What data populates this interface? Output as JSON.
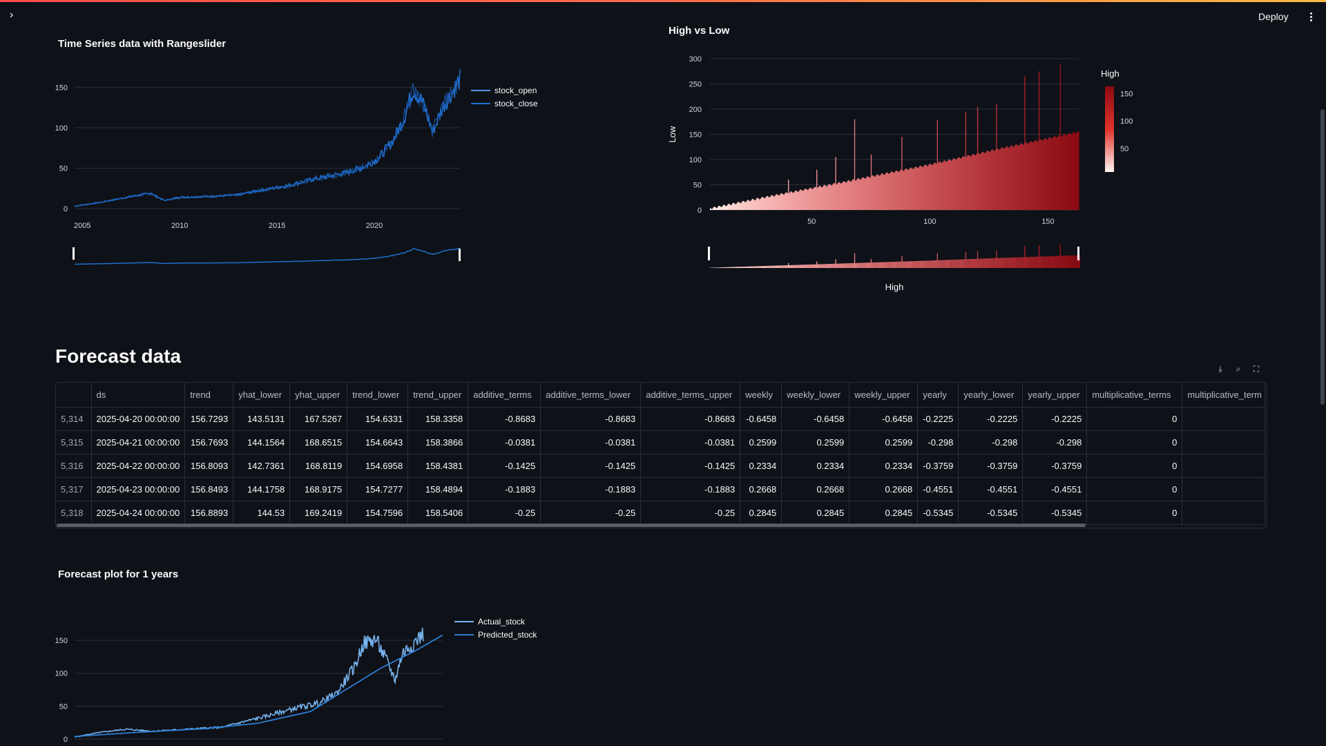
{
  "header": {
    "deploy_label": "Deploy"
  },
  "sections": {
    "ts_title": "Time Series data with Rangeslider",
    "hl_title": "High vs Low",
    "forecast_data_title": "Forecast data",
    "forecast_plot_title": "Forecast plot for 1 years"
  },
  "colors": {
    "accent_blue": "#1f6fd0",
    "light_blue": "#7ab8f5",
    "bg": "#0e1117",
    "red_dark": "#8b0a12",
    "red_light": "#fff5f0"
  },
  "icons": {
    "expand": "chevron-right-icon",
    "menu": "kebab-menu-icon",
    "download": "download-icon",
    "search": "search-icon",
    "fullscreen": "fullscreen-icon"
  },
  "table": {
    "columns": [
      "",
      "ds",
      "trend",
      "yhat_lower",
      "yhat_upper",
      "trend_lower",
      "trend_upper",
      "additive_terms",
      "additive_terms_lower",
      "additive_terms_upper",
      "weekly",
      "weekly_lower",
      "weekly_upper",
      "yearly",
      "yearly_lower",
      "yearly_upper",
      "multiplicative_terms",
      "multiplicative_term"
    ],
    "rows": [
      [
        "5,314",
        "2025-04-20 00:00:00",
        "156.7293",
        "143.5131",
        "167.5267",
        "154.6331",
        "158.3358",
        "-0.8683",
        "-0.8683",
        "-0.8683",
        "-0.6458",
        "-0.6458",
        "-0.6458",
        "-0.2225",
        "-0.2225",
        "-0.2225",
        "0",
        ""
      ],
      [
        "5,315",
        "2025-04-21 00:00:00",
        "156.7693",
        "144.1564",
        "168.6515",
        "154.6643",
        "158.3866",
        "-0.0381",
        "-0.0381",
        "-0.0381",
        "0.2599",
        "0.2599",
        "0.2599",
        "-0.298",
        "-0.298",
        "-0.298",
        "0",
        ""
      ],
      [
        "5,316",
        "2025-04-22 00:00:00",
        "156.8093",
        "142.7361",
        "168.8119",
        "154.6958",
        "158.4381",
        "-0.1425",
        "-0.1425",
        "-0.1425",
        "0.2334",
        "0.2334",
        "0.2334",
        "-0.3759",
        "-0.3759",
        "-0.3759",
        "0",
        ""
      ],
      [
        "5,317",
        "2025-04-23 00:00:00",
        "156.8493",
        "144.1758",
        "168.9175",
        "154.7277",
        "158.4894",
        "-0.1883",
        "-0.1883",
        "-0.1883",
        "0.2668",
        "0.2668",
        "0.2668",
        "-0.4551",
        "-0.4551",
        "-0.4551",
        "0",
        ""
      ],
      [
        "5,318",
        "2025-04-24 00:00:00",
        "156.8893",
        "144.53",
        "169.2419",
        "154.7596",
        "158.5406",
        "-0.25",
        "-0.25",
        "-0.25",
        "0.2845",
        "0.2845",
        "0.2845",
        "-0.5345",
        "-0.5345",
        "-0.5345",
        "0",
        ""
      ]
    ]
  },
  "chart_data": [
    {
      "type": "line",
      "title": "Time Series data with Rangeslider",
      "x_ticks": [
        "2005",
        "2010",
        "2015",
        "2020"
      ],
      "y_ticks": [
        "0",
        "50",
        "100",
        "150"
      ],
      "ylim": [
        0,
        170
      ],
      "xlim": [
        2004.6,
        2024.4
      ],
      "series": [
        {
          "name": "stock_open"
        },
        {
          "name": "stock_close"
        }
      ],
      "x": [
        2004.6,
        2006,
        2007.5,
        2008.5,
        2009.2,
        2010,
        2011.5,
        2013,
        2014,
        2015.5,
        2017,
        2018.5,
        2019.5,
        2020.2,
        2020.9,
        2021.5,
        2022,
        2022.5,
        2023,
        2023.5,
        2024.4
      ],
      "y": [
        3,
        8,
        15,
        19,
        10,
        14,
        15,
        17,
        22,
        28,
        37,
        44,
        52,
        62,
        82,
        110,
        148,
        130,
        95,
        125,
        160
      ],
      "legend": "top-right",
      "rangeslider": true
    },
    {
      "type": "bar",
      "title": "High vs Low",
      "xlabel": "High",
      "ylabel": "Low",
      "x_ticks": [
        "50",
        "100",
        "150"
      ],
      "y_ticks": [
        "0",
        "50",
        "100",
        "150",
        "200",
        "250",
        "300"
      ],
      "xlim": [
        7,
        163
      ],
      "ylim": [
        0,
        300
      ],
      "colorbar": {
        "title": "High",
        "ticks": [
          "50",
          "100",
          "150"
        ]
      },
      "baseline_points": [
        [
          7,
          3
        ],
        [
          30,
          25
        ],
        [
          60,
          52
        ],
        [
          100,
          90
        ],
        [
          130,
          122
        ],
        [
          163,
          155
        ]
      ],
      "spikes": [
        [
          40,
          60
        ],
        [
          52,
          80
        ],
        [
          60,
          105
        ],
        [
          68,
          180
        ],
        [
          75,
          110
        ],
        [
          88,
          145
        ],
        [
          103,
          178
        ],
        [
          115,
          195
        ],
        [
          120,
          205
        ],
        [
          128,
          210
        ],
        [
          140,
          265
        ],
        [
          146,
          275
        ],
        [
          155,
          288
        ]
      ],
      "rangeslider": true
    },
    {
      "type": "line",
      "title": "Forecast plot for 1 years",
      "y_ticks": [
        "0",
        "50",
        "100",
        "150"
      ],
      "ylim": [
        0,
        170
      ],
      "xlim": [
        2004.6,
        2025.5
      ],
      "series": [
        {
          "name": "Actual_stock",
          "x": [
            2004.6,
            2006,
            2007.5,
            2009,
            2011,
            2013,
            2014,
            2015.5,
            2017,
            2018.5,
            2019.5,
            2020.5,
            2021,
            2021.7,
            2022.3,
            2022.8,
            2023.2,
            2023.8,
            2024.4
          ],
          "y": [
            3,
            10,
            15,
            12,
            15,
            18,
            25,
            35,
            46,
            55,
            70,
            110,
            145,
            152,
            120,
            90,
            130,
            145,
            160
          ]
        },
        {
          "name": "Predicted_stock",
          "x": [
            2004.6,
            2008,
            2012,
            2015,
            2018,
            2020,
            2022,
            2024,
            2025.5
          ],
          "y": [
            4,
            10,
            16,
            24,
            42,
            75,
            108,
            135,
            158
          ]
        }
      ],
      "legend": "top-right"
    }
  ]
}
